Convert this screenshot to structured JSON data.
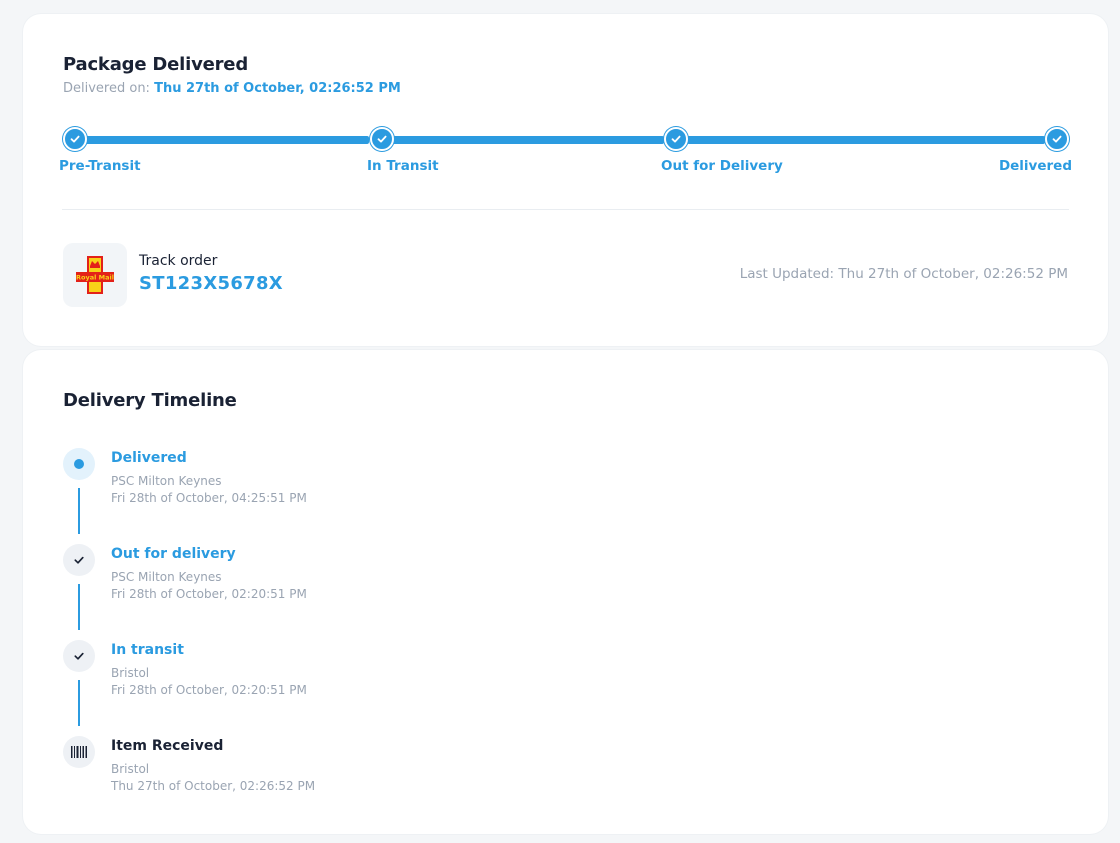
{
  "summary": {
    "title": "Package Delivered",
    "delivered_prefix": "Delivered on:",
    "delivered_date": "Thu 27th of October, 02:26:52 PM"
  },
  "progress": {
    "color": "#2b9be0",
    "steps": [
      {
        "label": "Pre-Transit",
        "icon": "check-icon"
      },
      {
        "label": "In Transit",
        "icon": "check-icon"
      },
      {
        "label": "Out for Delivery",
        "icon": "check-icon"
      },
      {
        "label": "Delivered",
        "icon": "check-icon"
      }
    ]
  },
  "tracking": {
    "carrier_logo_text": "Royal Mail",
    "label": "Track order",
    "number": "ST123X5678X",
    "last_updated": "Last Updated: Thu 27th of October, 02:26:52 PM"
  },
  "timeline": {
    "title": "Delivery Timeline",
    "events": [
      {
        "title": "Delivered",
        "location": "PSC Milton Keynes",
        "time": "Fri 28th of October, 04:25:51 PM",
        "icon": "current-dot-icon"
      },
      {
        "title": "Out for delivery",
        "location": "PSC Milton Keynes",
        "time": "Fri 28th of October, 02:20:51 PM",
        "icon": "check-icon"
      },
      {
        "title": "In transit",
        "location": "Bristol",
        "time": "Fri 28th of October, 02:20:51 PM",
        "icon": "check-icon"
      },
      {
        "title": "Item Received",
        "location": "Bristol",
        "time": "Thu 27th of October, 02:26:52 PM",
        "icon": "barcode-icon"
      }
    ]
  }
}
